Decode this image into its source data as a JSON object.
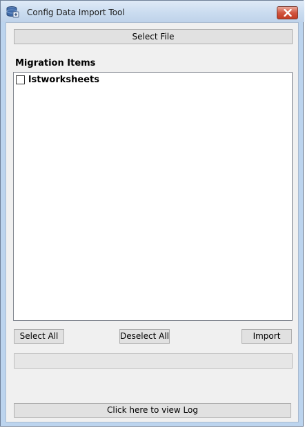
{
  "window": {
    "title": "Config Data Import Tool",
    "icons": {
      "app": "database-icon",
      "close": "close-icon"
    }
  },
  "toolbar": {
    "select_file_label": "Select File"
  },
  "migration": {
    "heading": "Migration Items",
    "items": [
      {
        "label": "lstworksheets",
        "checked": false
      }
    ]
  },
  "actions": {
    "select_all_label": "Select All",
    "deselect_all_label": "Deselect All",
    "import_label": "Import"
  },
  "progress": {
    "value": 0
  },
  "footer": {
    "view_log_label": "Click here to view  Log"
  },
  "colors": {
    "client_background": "#f0f0f0",
    "button_face": "#e1e1e1",
    "close_button": "#c43c24"
  }
}
